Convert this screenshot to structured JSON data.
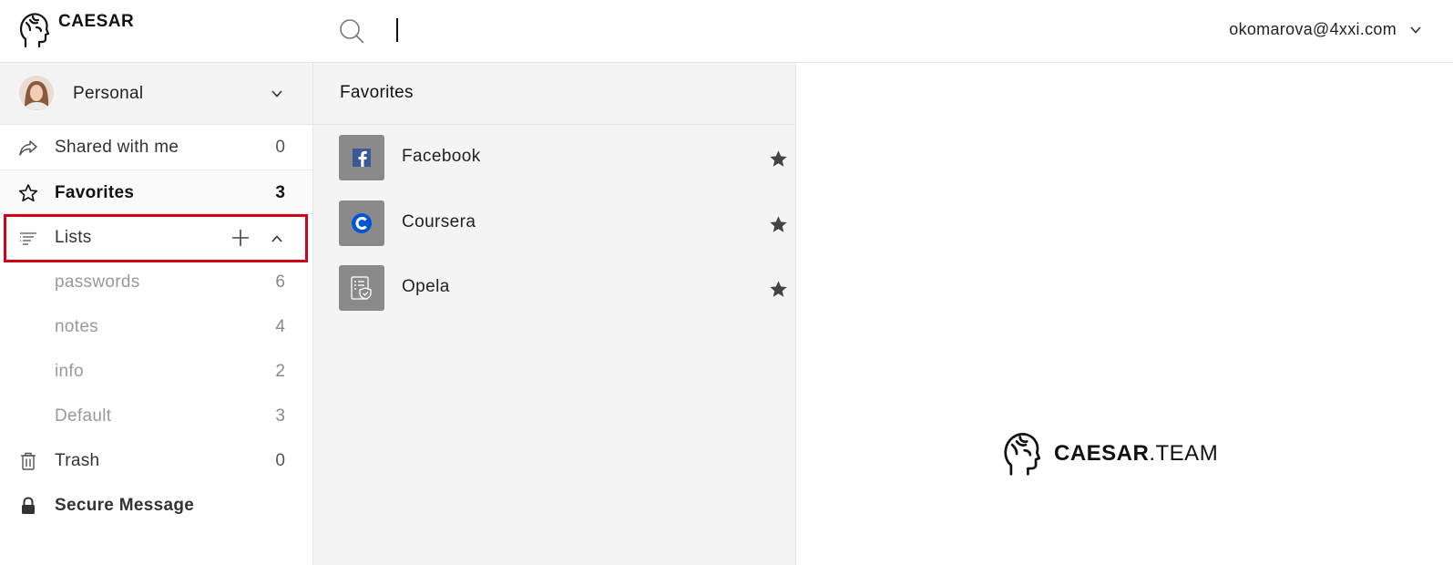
{
  "app": {
    "logo_text": "CAESAR",
    "user_email": "okomarova@4xxi.com"
  },
  "account": {
    "name": "Personal"
  },
  "sidebar": {
    "items": [
      {
        "label": "Shared with me",
        "count": "0",
        "icon": "share-arrow-icon"
      },
      {
        "label": "Favorites",
        "count": "3",
        "icon": "star-outline-icon"
      },
      {
        "label": "Lists",
        "icon": "list-icon"
      },
      {
        "label": "passwords",
        "count": "6"
      },
      {
        "label": "notes",
        "count": "4"
      },
      {
        "label": "info",
        "count": "2"
      },
      {
        "label": "Default",
        "count": "3"
      },
      {
        "label": "Trash",
        "count": "0",
        "icon": "trash-icon"
      },
      {
        "label": "Secure Message",
        "icon": "lock-icon"
      }
    ]
  },
  "panel": {
    "title": "Favorites",
    "entries": [
      {
        "name": "Facebook",
        "icon": "facebook-icon",
        "favorite": true
      },
      {
        "name": "Coursera",
        "icon": "coursera-icon",
        "favorite": true
      },
      {
        "name": "Opela",
        "icon": "document-shield-icon",
        "favorite": true
      }
    ]
  },
  "brand": {
    "bold": "CAESAR",
    "suffix": ".TEAM"
  },
  "colors": {
    "highlight": "#d0021b",
    "facebook": "#3b5998",
    "coursera": "#0056d2",
    "panel_bg": "#f4f4f4"
  }
}
